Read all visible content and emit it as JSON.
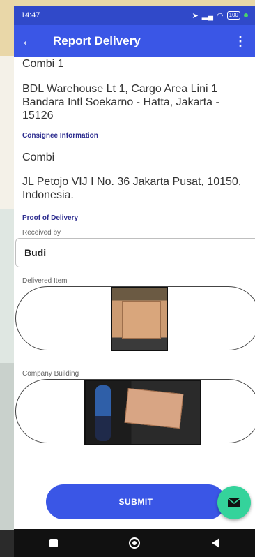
{
  "status": {
    "time": "14:47",
    "battery": "100"
  },
  "appbar": {
    "title": "Report Delivery"
  },
  "shipper": {
    "name": "Combi 1",
    "address": "BDL Warehouse Lt 1, Cargo Area Lini 1 Bandara Intl Soekarno - Hatta, Jakarta - 15126"
  },
  "consignee": {
    "heading": "Consignee Information",
    "name": "Combi",
    "address": "JL Petojo VIJ I No. 36 Jakarta Pusat, 10150, Indonesia."
  },
  "proof": {
    "heading": "Proof of Delivery",
    "received_by_label": "Received by",
    "received_by_value": "Budi",
    "delivered_item_label": "Delivered Item",
    "company_building_label": "Company Building"
  },
  "submit_label": "SUBMIT",
  "colors": {
    "primary": "#3a56e6",
    "statusbar": "#3049c9",
    "fab": "#34d39b",
    "section": "#2d2d8f"
  },
  "icons": [
    "back-arrow-icon",
    "more-vert-icon",
    "mail-icon",
    "recents-icon",
    "home-icon",
    "back-nav-icon"
  ]
}
